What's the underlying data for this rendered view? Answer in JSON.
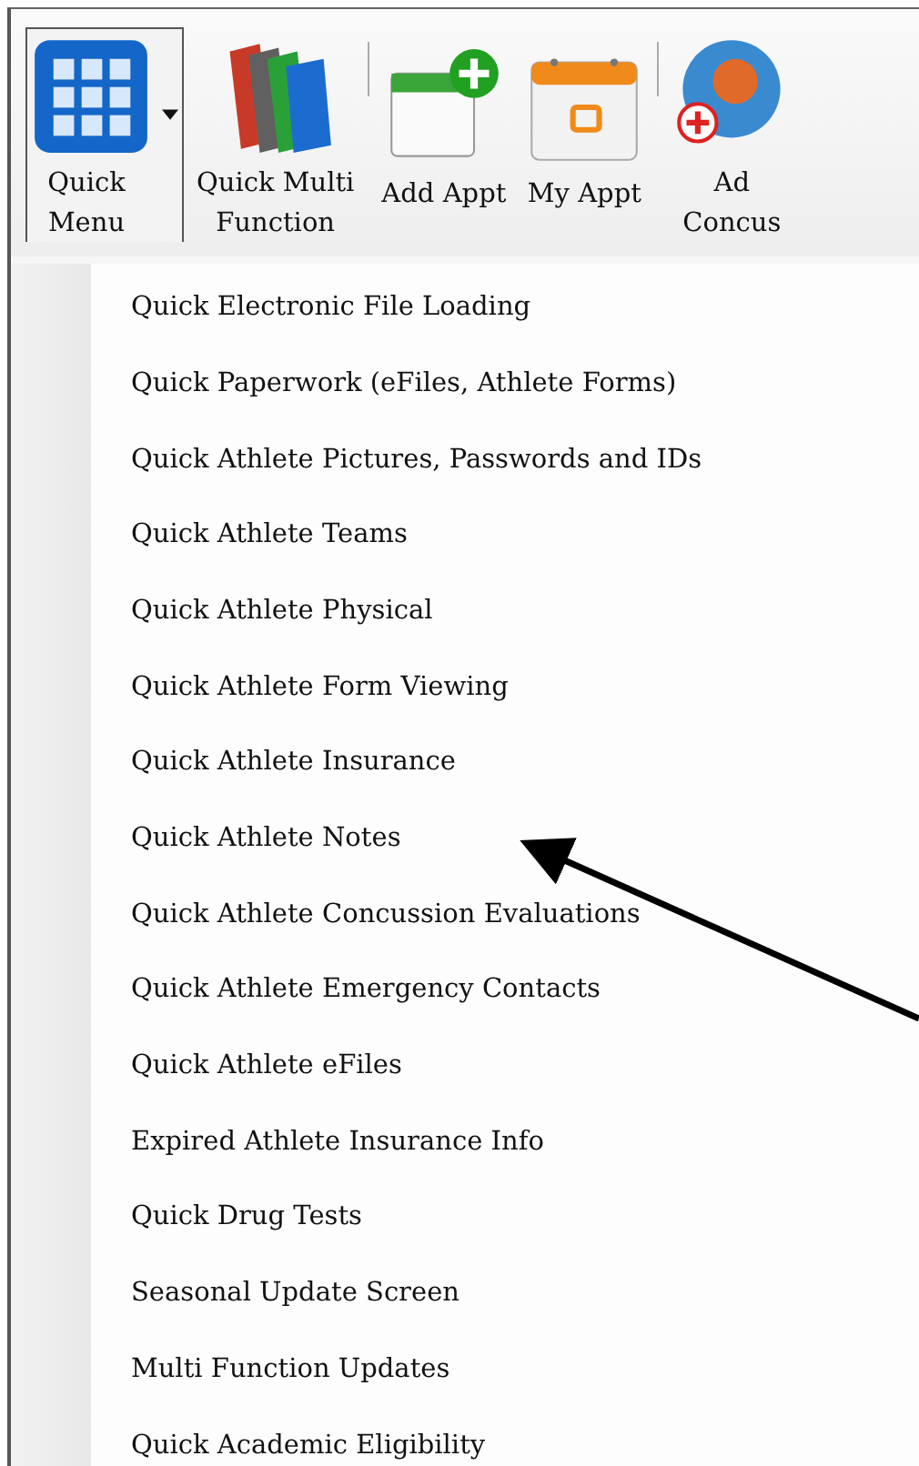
{
  "toolbar": {
    "buttons": [
      {
        "kind": "split",
        "label": [
          "Quick",
          "Menu"
        ],
        "selected": true
      },
      {
        "kind": "plain",
        "label": [
          "Quick Multi",
          "Function"
        ],
        "selected": false
      },
      {
        "kind": "separator"
      },
      {
        "kind": "plain",
        "label": [
          "Add Appt"
        ],
        "selected": false
      },
      {
        "kind": "plain",
        "label": [
          "My Appt"
        ],
        "selected": false
      },
      {
        "kind": "separator"
      },
      {
        "kind": "plain",
        "label": [
          "Ad",
          "Concus"
        ],
        "selected": false
      }
    ]
  },
  "menu": {
    "items": [
      {
        "label": "Quick Electronic File Loading"
      },
      {
        "label": "Quick Paperwork (eFiles, Athlete Forms)"
      },
      {
        "label": "Quick Athlete Pictures, Passwords and IDs"
      },
      {
        "label": "Quick Athlete Teams"
      },
      {
        "label": "Quick Athlete Physical"
      },
      {
        "label": "Quick Athlete Form Viewing"
      },
      {
        "label": "Quick Athlete Insurance"
      },
      {
        "label": "Quick Athlete Notes"
      },
      {
        "label": "Quick Athlete Concussion Evaluations"
      },
      {
        "label": "Quick Athlete Emergency Contacts"
      },
      {
        "label": "Quick Athlete eFiles"
      },
      {
        "label": "Expired Athlete Insurance Info"
      },
      {
        "label": "Quick Drug Tests"
      },
      {
        "label": "Seasonal Update Screen"
      },
      {
        "label": "Multi Function Updates"
      },
      {
        "label": "Quick Academic Eligibility"
      }
    ]
  }
}
